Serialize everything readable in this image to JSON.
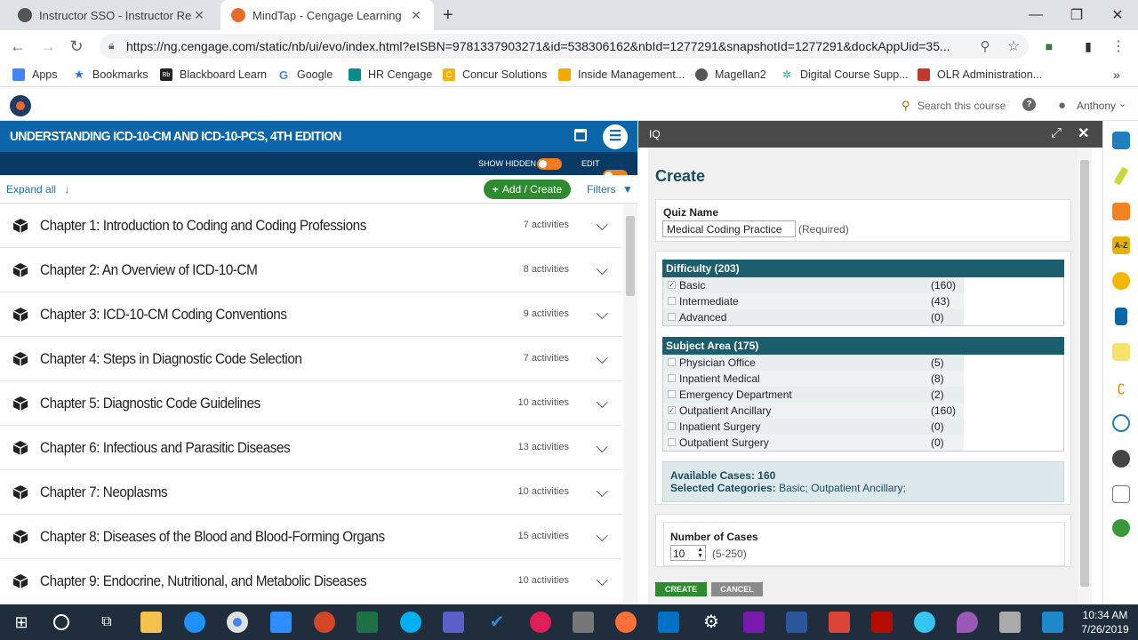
{
  "browser": {
    "tabs": [
      {
        "title": "Instructor SSO - Instructor Resou",
        "active": false
      },
      {
        "title": "MindTap - Cengage Learning",
        "active": true
      }
    ],
    "url": "https://ng.cengage.com/static/nb/ui/evo/index.html?eISBN=9781337903271&id=538306162&nbId=1277291&snapshotId=1277291&dockAppUid=35...",
    "bookmarks": [
      "Apps",
      "Bookmarks",
      "Blackboard Learn",
      "Google",
      "HR Cengage",
      "Concur Solutions",
      "Inside Management...",
      "Magellan2",
      "Digital Course Supp...",
      "OLR Administration..."
    ]
  },
  "header": {
    "search_label": "Search this course",
    "user": "Anthony"
  },
  "course": {
    "title": "UNDERSTANDING ICD-10-CM AND ICD-10-PCS, 4TH EDITION",
    "show_hidden": "SHOW HIDDEN",
    "edit": "EDIT",
    "expand_all": "Expand all",
    "add_create": "Add / Create",
    "filters": "Filters",
    "chapters": [
      {
        "title": "Chapter 1: Introduction to Coding and Coding Professions",
        "activities": "7 activities"
      },
      {
        "title": "Chapter 2: An Overview of ICD-10-CM",
        "activities": "8 activities"
      },
      {
        "title": "Chapter 3: ICD-10-CM Coding Conventions",
        "activities": "9 activities"
      },
      {
        "title": "Chapter 4: Steps in Diagnostic Code Selection",
        "activities": "7 activities"
      },
      {
        "title": "Chapter 5: Diagnostic Code Guidelines",
        "activities": "10 activities"
      },
      {
        "title": "Chapter 6: Infectious and Parasitic Diseases",
        "activities": "13 activities"
      },
      {
        "title": "Chapter 7: Neoplasms",
        "activities": "10 activities"
      },
      {
        "title": "Chapter 8: Diseases of the Blood and Blood-Forming Organs",
        "activities": "15 activities"
      },
      {
        "title": "Chapter 9: Endocrine, Nutritional, and Metabolic Diseases",
        "activities": "10 activities"
      }
    ]
  },
  "iq": {
    "panel_title": "IQ",
    "heading": "Create",
    "quiz_name_label": "Quiz Name",
    "quiz_name_value": "Medical Coding Practice",
    "required": "(Required)",
    "difficulty_header": "Difficulty (203)",
    "difficulty": [
      {
        "label": "Basic",
        "count": "(160)",
        "checked": true
      },
      {
        "label": "Intermediate",
        "count": "(43)",
        "checked": false
      },
      {
        "label": "Advanced",
        "count": "(0)",
        "checked": false
      }
    ],
    "subject_header": "Subject Area (175)",
    "subjects": [
      {
        "label": "Physician Office",
        "count": "(5)",
        "checked": false
      },
      {
        "label": "Inpatient Medical",
        "count": "(8)",
        "checked": false
      },
      {
        "label": "Emergency Department",
        "count": "(2)",
        "checked": false
      },
      {
        "label": "Outpatient Ancillary",
        "count": "(160)",
        "checked": true
      },
      {
        "label": "Inpatient Surgery",
        "count": "(0)",
        "checked": false
      },
      {
        "label": "Outpatient Surgery",
        "count": "(0)",
        "checked": false
      }
    ],
    "available_cases": "Available Cases: 160",
    "selected_label": "Selected Categories:",
    "selected_value": "Basic; Outpatient Ancillary;",
    "num_cases_label": "Number of Cases",
    "num_cases_value": "10",
    "num_cases_range": "(5-250)",
    "create_btn": "CREATE",
    "cancel_btn": "CANCEL"
  },
  "taskbar": {
    "time": "10:34 AM",
    "date": "7/26/2019"
  },
  "colors": {
    "blue": "#0a66a8",
    "navy": "#0a3a63",
    "green": "#2e8b2e",
    "teal": "#1c5d6e"
  }
}
